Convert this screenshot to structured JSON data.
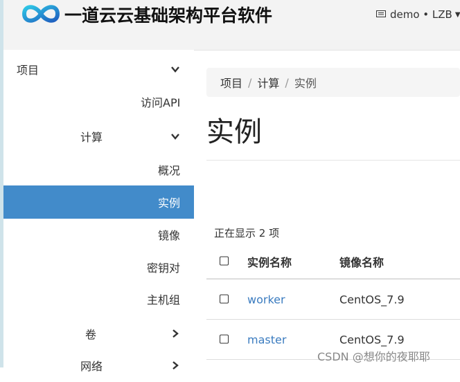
{
  "app": {
    "brand": "一道云云基础架构平台软件",
    "user_menu": "demo • LZB",
    "colors": {
      "accent": "#428bca",
      "link": "#3a7bbf",
      "topbar_bg": "#f3f3f3"
    }
  },
  "sidebar": {
    "items": [
      {
        "label": "项目",
        "chevron": "down"
      },
      {
        "label": "访问API"
      },
      {
        "label": "计算",
        "chevron": "down"
      },
      {
        "label": "概况"
      },
      {
        "label": "实例",
        "active": true
      },
      {
        "label": "镜像"
      },
      {
        "label": "密钥对"
      },
      {
        "label": "主机组"
      },
      {
        "label": "卷",
        "chevron": "right"
      },
      {
        "label": "网络",
        "chevron": "right"
      }
    ]
  },
  "breadcrumb": {
    "items": [
      "项目",
      "计算",
      "实例"
    ]
  },
  "page": {
    "title": "实例",
    "count_text": "正在显示 2 项"
  },
  "table": {
    "headers": [
      "实例名称",
      "镜像名称"
    ],
    "rows": [
      {
        "name": "worker",
        "image": "CentOS_7.9"
      },
      {
        "name": "master",
        "image": "CentOS_7.9"
      }
    ]
  },
  "watermark": "CSDN @想你的夜耶耶"
}
